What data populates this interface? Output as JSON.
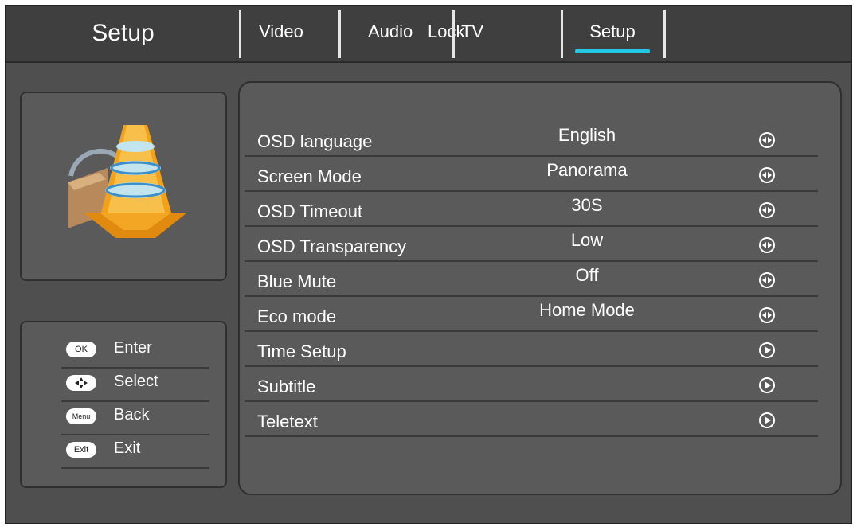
{
  "header": {
    "title": "Setup",
    "tabs": [
      {
        "label": "Video"
      },
      {
        "label": "Audio"
      },
      {
        "label": "Lock"
      },
      {
        "label": "TV"
      },
      {
        "label": "Setup",
        "active": true
      }
    ]
  },
  "help": [
    {
      "key": "OK",
      "action": "Enter"
    },
    {
      "key": "",
      "action": "Select",
      "icon": "dpad-icon"
    },
    {
      "key": "Menu",
      "action": "Back"
    },
    {
      "key": "Exit",
      "action": "Exit"
    }
  ],
  "menu": {
    "items": [
      {
        "label": "OSD language",
        "value": "English",
        "icon": "left-right-arrows-icon"
      },
      {
        "label": "Screen Mode",
        "value": "Panorama",
        "icon": "left-right-arrows-icon"
      },
      {
        "label": "OSD Timeout",
        "value": "30S",
        "icon": "left-right-arrows-icon"
      },
      {
        "label": "OSD Transparency",
        "value": "Low",
        "icon": "left-right-arrows-icon"
      },
      {
        "label": "Blue Mute",
        "value": "Off",
        "icon": "left-right-arrows-icon"
      },
      {
        "label": "Eco mode",
        "value": "Home Mode",
        "icon": "left-right-arrows-icon"
      },
      {
        "label": "Time Setup",
        "value": "",
        "icon": "enter-arrow-icon"
      },
      {
        "label": "Subtitle",
        "value": "",
        "icon": "enter-arrow-icon"
      },
      {
        "label": "Teletext",
        "value": "",
        "icon": "enter-arrow-icon"
      }
    ]
  },
  "colors": {
    "background": "#4f4f4f",
    "header": "#3f3f3f",
    "accent": "#23c8e6"
  }
}
